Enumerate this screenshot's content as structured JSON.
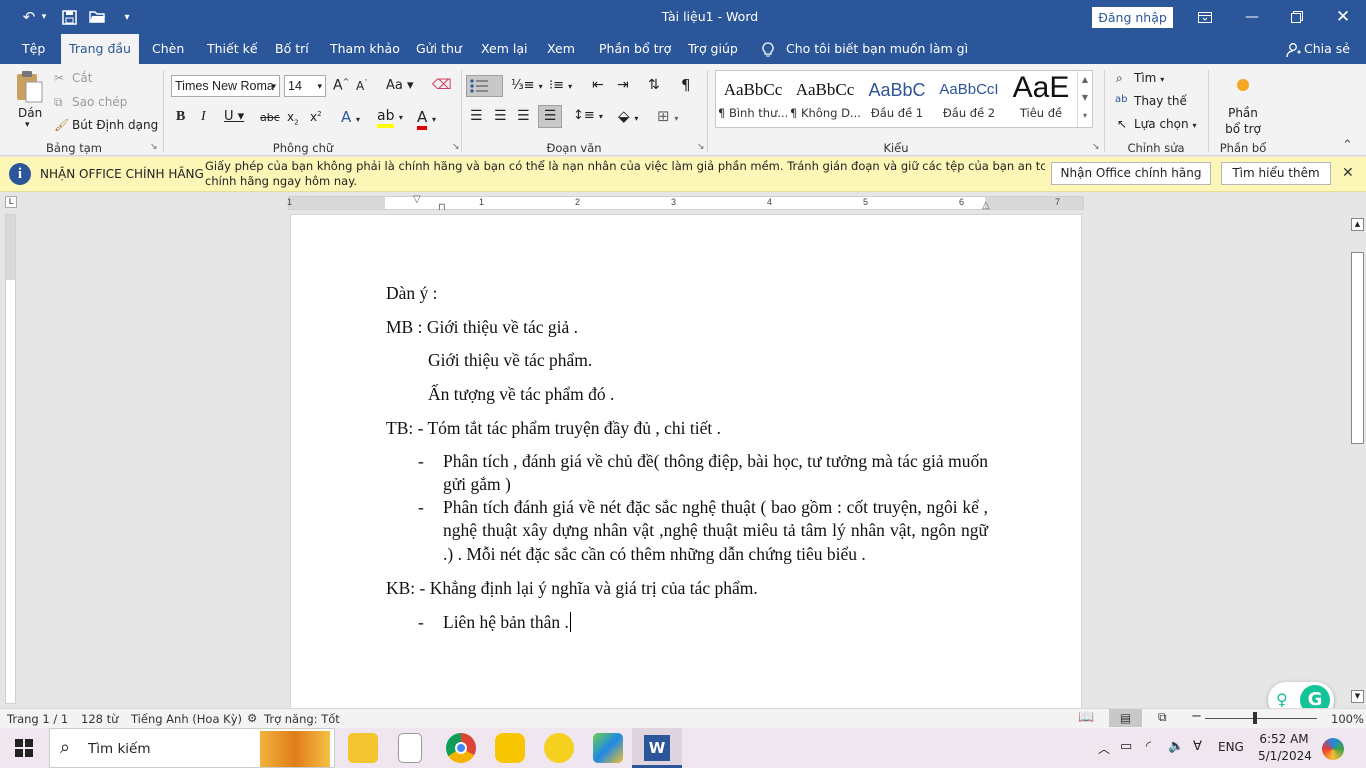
{
  "app": {
    "title": "Tài liệu1  -  Word",
    "signin": "Đăng nhập",
    "share": "Chia sẻ",
    "tell_me": "Cho tôi biết bạn muốn làm gì",
    "accent": "#2b579a"
  },
  "tabs": [
    "Tệp",
    "Trang đầu",
    "Chèn",
    "Thiết kế",
    "Bố trí",
    "Tham khảo",
    "Gửi thư",
    "Xem lại",
    "Xem",
    "Phần bổ trợ",
    "Trợ giúp"
  ],
  "ribbon": {
    "clipboard": {
      "paste": "Dán",
      "cut": "Cắt",
      "copy": "Sao chép",
      "format_painter": "Bút Định dạng",
      "label": "Bảng tạm"
    },
    "font": {
      "name": "Times New Roma",
      "size": "14",
      "label": "Phông chữ"
    },
    "paragraph": {
      "label": "Đoạn văn"
    },
    "styles": {
      "label": "Kiểu",
      "items": [
        {
          "preview": "AaBbCc",
          "name": "¶ Bình thư..."
        },
        {
          "preview": "AaBbCc",
          "name": "¶ Không D..."
        },
        {
          "preview": "AaBbC",
          "name": "Đầu đề 1"
        },
        {
          "preview": "AaBbCcI",
          "name": "Đầu đề 2"
        },
        {
          "preview": "AaE",
          "name": "Tiêu đề"
        }
      ]
    },
    "editing": {
      "find": "Tìm",
      "replace": "Thay thế",
      "select": "Lựa chọn",
      "label": "Chỉnh sửa"
    },
    "addins": {
      "line1": "Phần",
      "line2": "bổ trợ",
      "label": "Phần bổ trợ"
    }
  },
  "message_bar": {
    "title": "NHẬN OFFICE CHÍNH HÃNG",
    "line1": "Giấy phép của bạn không phải là chính hãng và bạn có thể là nạn nhân của việc làm giả phần mềm. Tránh gián đoạn và giữ các tệp của bạn an toàn với Office",
    "line2": "chính hãng ngay hôm nay.",
    "btn_genuine": "Nhận Office chính hãng",
    "btn_learn": "Tìm hiểu thêm"
  },
  "ruler": [
    "1",
    "1",
    "2",
    "3",
    "4",
    "5",
    "6",
    "7"
  ],
  "document": {
    "heading": "Dàn ý :",
    "mb1": "MB : Giới thiệu về tác giả .",
    "mb2": "Giới thiệu về tác phẩm.",
    "mb3": "Ấn tượng về tác phẩm đó .",
    "tb": "TB: - Tóm tắt tác phẩm truyện đầy đủ , chi tiết .",
    "tb_bullet1": "Phân tích , đánh giá về chủ đề( thông điệp, bài học, tư tưởng mà tác giả muốn gửi gắm )",
    "tb_bullet2": "Phân tích đánh giá về nét đặc sắc nghệ thuật ( bao gồm : cốt truyện, ngôi kể , nghệ thuật xây dựng nhân vật ,nghệ thuật miêu tả tâm lý nhân vật, ngôn ngữ .) . Mỗi nét đặc sắc cần có thêm những dẫn chứng tiêu biểu .",
    "kb": "KB: - Khẳng định lại ý nghĩa và giá trị của tác phẩm.",
    "kb_bullet": "Liên hệ bản thân ."
  },
  "status": {
    "page": "Trang 1 / 1",
    "words": "128 từ",
    "language": "Tiếng Anh (Hoa Kỳ)",
    "accessibility": "Trợ năng: Tốt",
    "zoom": "100%"
  },
  "taskbar": {
    "search": "Tìm kiếm",
    "language": "ENG",
    "time": "6:52 AM",
    "date": "5/1/2024"
  }
}
